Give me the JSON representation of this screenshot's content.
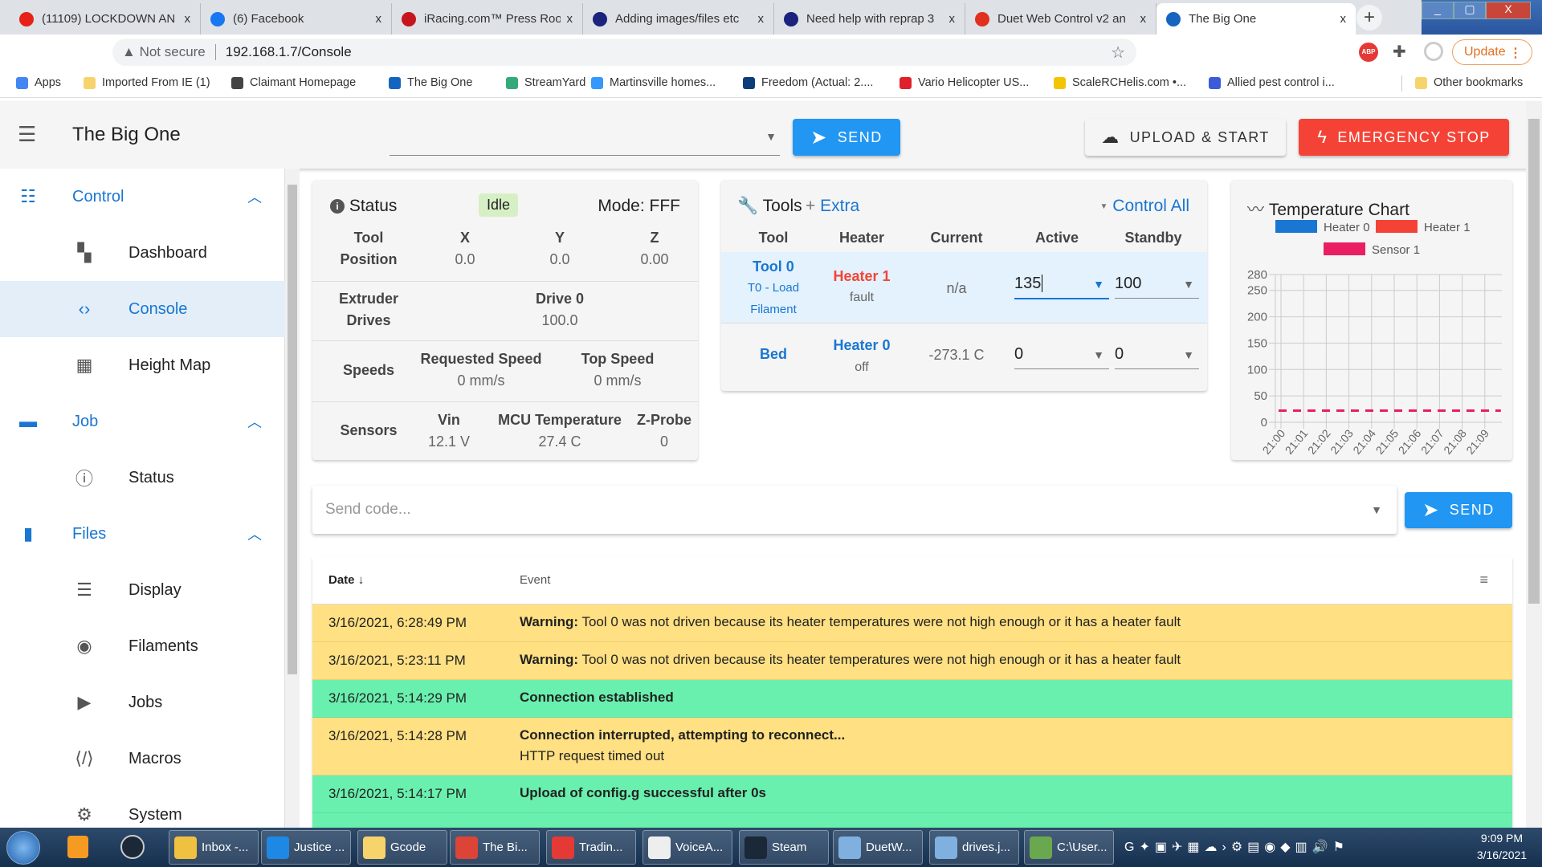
{
  "browser": {
    "tabs": [
      {
        "title": "(11109) LOCKDOWN AN",
        "icon": "youtube-icon",
        "color": "#e62117"
      },
      {
        "title": "(6) Facebook",
        "icon": "facebook-icon",
        "color": "#1877f2"
      },
      {
        "title": "iRacing.com™ Press Roo",
        "icon": "iracing-icon",
        "color": "#c4161c"
      },
      {
        "title": "Adding images/files etc",
        "icon": "reprap-icon",
        "color": "#1a237e"
      },
      {
        "title": "Need help with reprap 3",
        "icon": "reprap-icon",
        "color": "#1a237e"
      },
      {
        "title": "Duet Web Control v2 an",
        "icon": "duet-icon",
        "color": "#e0301e"
      },
      {
        "title": "The Big One",
        "icon": "drop-icon",
        "color": "#1565c0"
      }
    ],
    "close_glyph": "x",
    "address": {
      "security": "Not secure",
      "url": "192.168.1.7/Console"
    },
    "update_label": "Update",
    "bookmarks": [
      "Apps",
      "Imported From IE (1)",
      "Claimant Homepage",
      "The Big One",
      "StreamYard",
      "Martinsville homes...",
      "Freedom (Actual: 2....",
      "Vario Helicopter US...",
      "ScaleRCHelis.com •...",
      "Allied pest control i..."
    ],
    "other_bookmarks": "Other bookmarks"
  },
  "app": {
    "title": "The Big One",
    "send_label": "SEND",
    "upload_label": "UPLOAD & START",
    "estop_label": "EMERGENCY STOP",
    "colors": {
      "primary": "#1976d2",
      "accent": "#2196f3",
      "danger": "#f44336",
      "warning_row": "#ffe082",
      "success_row": "#69f0ae"
    }
  },
  "sidebar": [
    {
      "label": "Control",
      "icon": "tune-icon",
      "group": true
    },
    {
      "label": "Dashboard",
      "icon": "dashboard-icon"
    },
    {
      "label": "Console",
      "icon": "code-icon",
      "selected": true
    },
    {
      "label": "Height Map",
      "icon": "grid-icon"
    },
    {
      "label": "Job",
      "icon": "printer-icon",
      "group": true
    },
    {
      "label": "Status",
      "icon": "info-icon"
    },
    {
      "label": "Files",
      "icon": "sd-card-icon",
      "group": true
    },
    {
      "label": "Display",
      "icon": "list-icon"
    },
    {
      "label": "Filaments",
      "icon": "radio-icon"
    },
    {
      "label": "Jobs",
      "icon": "play-icon"
    },
    {
      "label": "Macros",
      "icon": "macro-icon"
    },
    {
      "label": "System",
      "icon": "gear-icon"
    }
  ],
  "status": {
    "title": "Status",
    "state": "Idle",
    "mode": "Mode: FFF",
    "pos_headers": [
      "Tool",
      "X",
      "Y",
      "Z"
    ],
    "pos_label": "Position",
    "pos_values": [
      "0.0",
      "0.0",
      "0.00"
    ],
    "extruder_label": "Extruder",
    "drives_label": "Drives",
    "drive_name": "Drive 0",
    "drive_value": "100.0",
    "speeds_label": "Speeds",
    "req_speed_label": "Requested Speed",
    "req_speed": "0 mm/s",
    "top_speed_label": "Top Speed",
    "top_speed": "0 mm/s",
    "sensors_label": "Sensors",
    "vin_label": "Vin",
    "vin": "12.1 V",
    "mcu_label": "MCU Temperature",
    "mcu": "27.4 C",
    "zprobe_label": "Z-Probe",
    "zprobe": "0"
  },
  "tools": {
    "title": "Tools",
    "extra": "Extra",
    "control_all": "Control All",
    "headers": [
      "Tool",
      "Heater",
      "Current",
      "Active",
      "Standby"
    ],
    "rows": [
      {
        "tool": "Tool 0",
        "sub1": "T0 - Load",
        "sub2": "Filament",
        "heater": "Heater 1",
        "heater_state": "fault",
        "current": "n/a",
        "active": "135",
        "standby": "100"
      },
      {
        "tool": "Bed",
        "heater": "Heater 0",
        "heater_state": "off",
        "current": "-273.1 C",
        "active": "0",
        "standby": "0"
      }
    ]
  },
  "chart_data": {
    "type": "line",
    "title": "Temperature Chart",
    "legend": [
      "Heater 0",
      "Heater 1",
      "Sensor 1"
    ],
    "legend_colors": [
      "#1976d2",
      "#f44336",
      "#e91e63"
    ],
    "legend_placement": "top",
    "x_ticks": [
      "21:00",
      "21:01",
      "21:02",
      "21:03",
      "21:04",
      "21:05",
      "21:06",
      "21:07",
      "21:08",
      "21:09"
    ],
    "y_ticks": [
      0,
      50,
      100,
      150,
      200,
      250,
      280
    ],
    "ylim": [
      0,
      280
    ],
    "grid": true,
    "series": [
      {
        "name": "Sensor 1",
        "style": "dashed",
        "values": [
          22,
          22,
          22,
          22,
          22,
          22,
          22,
          22,
          22,
          22
        ]
      }
    ]
  },
  "console": {
    "placeholder": "Send code...",
    "send_label": "SEND",
    "date_header": "Date",
    "event_header": "Event",
    "rows": [
      {
        "date": "3/16/2021, 6:28:49 PM",
        "bold": "Warning:",
        "text": " Tool 0 was not driven because its heater temperatures were not high enough or it has a heater fault",
        "type": "warning"
      },
      {
        "date": "3/16/2021, 5:23:11 PM",
        "bold": "Warning:",
        "text": " Tool 0 was not driven because its heater temperatures were not high enough or it has a heater fault",
        "type": "warning"
      },
      {
        "date": "3/16/2021, 5:14:29 PM",
        "bold": "Connection established",
        "text": "",
        "type": "success"
      },
      {
        "date": "3/16/2021, 5:14:28 PM",
        "bold": "Connection interrupted, attempting to reconnect...",
        "text": "HTTP request timed out",
        "type": "warning"
      },
      {
        "date": "3/16/2021, 5:14:17 PM",
        "bold": "Upload of config.g successful after 0s",
        "text": "",
        "type": "success"
      }
    ]
  },
  "taskbar": {
    "items": [
      "Inbox -...",
      "Justice ...",
      "Gcode",
      "The Bi...",
      "Tradin...",
      "VoiceA...",
      "Steam",
      "DuetW...",
      "drives.j...",
      "C:\\User..."
    ],
    "time": "9:09 PM",
    "date": "3/16/2021"
  }
}
